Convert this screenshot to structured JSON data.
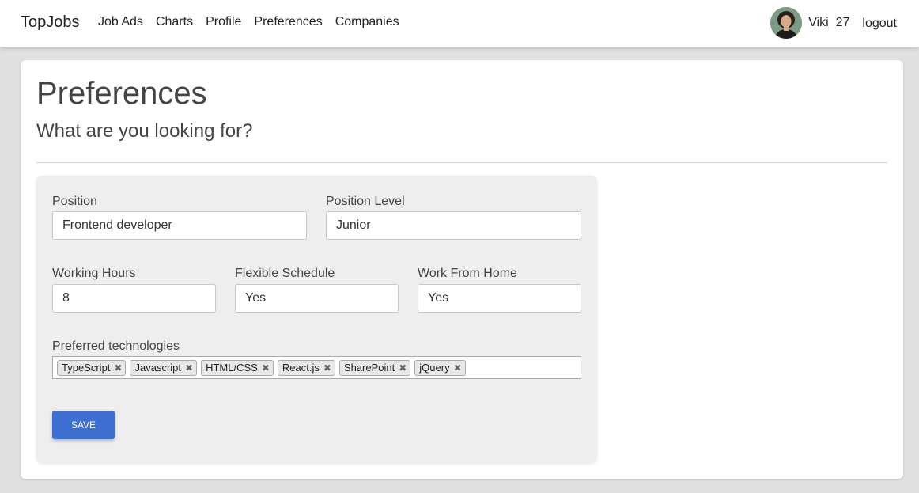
{
  "navbar": {
    "brand": "TopJobs",
    "links": [
      "Job Ads",
      "Charts",
      "Profile",
      "Preferences",
      "Companies"
    ],
    "username": "Viki_27",
    "logout": "logout"
  },
  "page": {
    "title": "Preferences",
    "subtitle": "What are you looking for?"
  },
  "form": {
    "position": {
      "label": "Position",
      "value": "Frontend developer"
    },
    "position_level": {
      "label": "Position Level",
      "value": "Junior"
    },
    "working_hours": {
      "label": "Working Hours",
      "value": "8"
    },
    "flexible_schedule": {
      "label": "Flexible Schedule",
      "value": "Yes"
    },
    "work_from_home": {
      "label": "Work From Home",
      "value": "Yes"
    },
    "technologies": {
      "label": "Preferred technologies",
      "tags": [
        "TypeScript",
        "Javascript",
        "HTML/CSS",
        "React.js",
        "SharePoint",
        "jQuery"
      ]
    },
    "save_label": "SAVE"
  },
  "colors": {
    "accent": "#3d6fd1",
    "panel": "#eeeeee",
    "page_background": "#e0e0e0"
  },
  "icons": {
    "tag_remove": "close-icon"
  }
}
